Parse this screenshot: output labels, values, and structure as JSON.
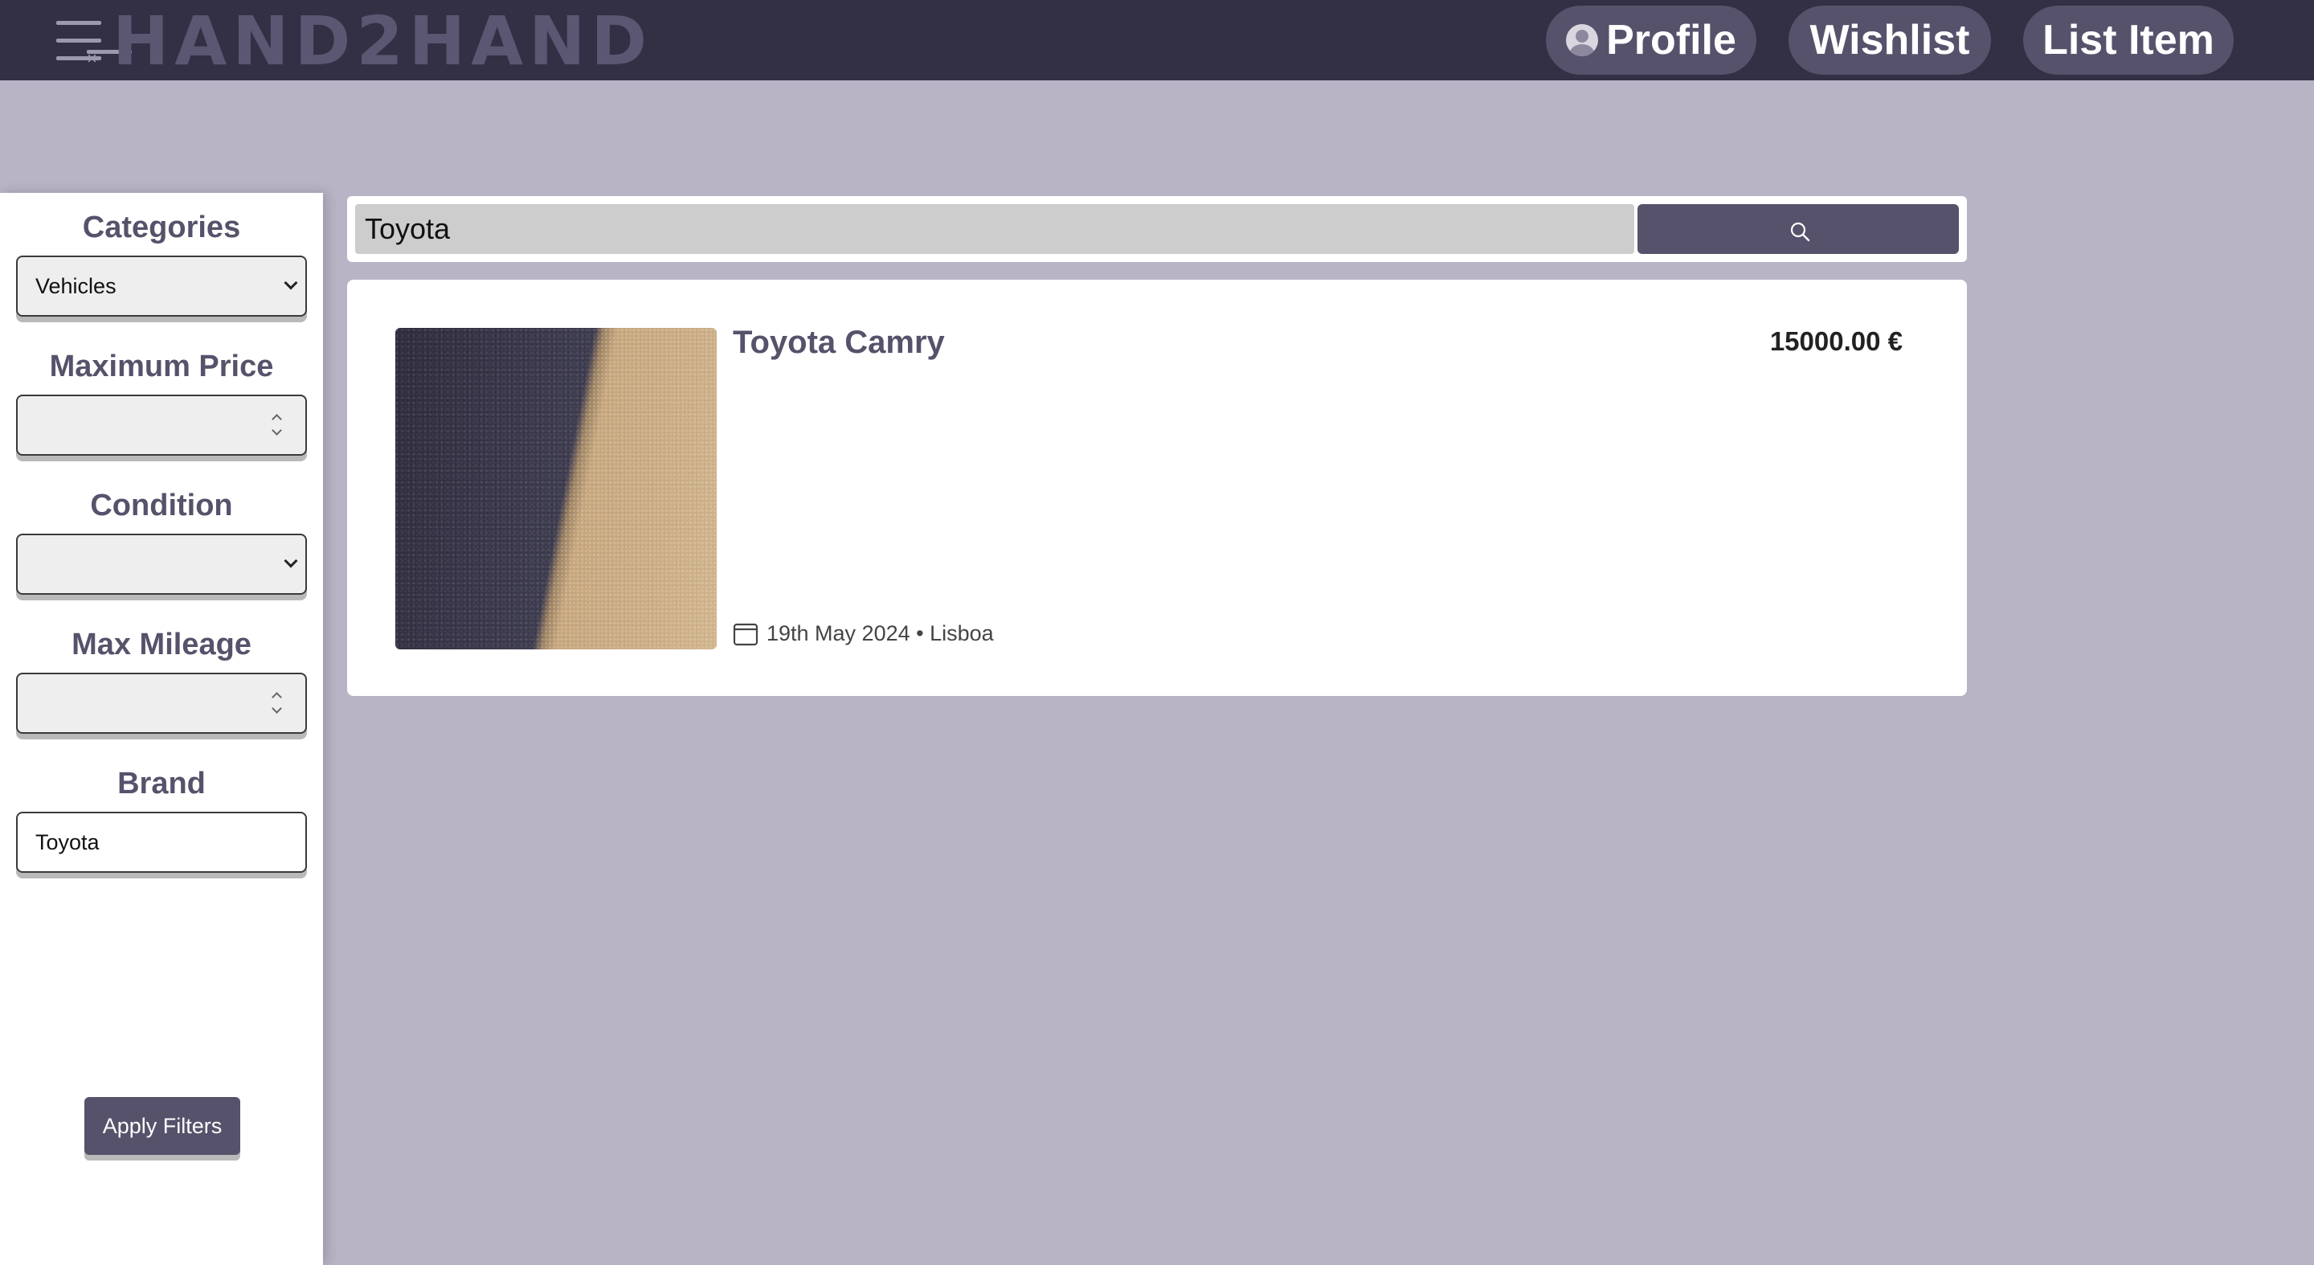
{
  "header": {
    "logo": "HAND2HAND",
    "nav": {
      "profile": "Profile",
      "wishlist": "Wishlist",
      "list_item": "List Item"
    }
  },
  "filters": {
    "categories": {
      "label": "Categories",
      "selected": "Vehicles"
    },
    "max_price": {
      "label": "Maximum Price",
      "value": ""
    },
    "condition": {
      "label": "Condition",
      "selected": ""
    },
    "max_mileage": {
      "label": "Max Mileage",
      "value": ""
    },
    "brand": {
      "label": "Brand",
      "value": "Toyota"
    },
    "apply_label": "Apply Filters"
  },
  "search": {
    "query": "Toyota"
  },
  "results": [
    {
      "title": "Toyota Camry",
      "price": "15000.00 €",
      "meta": "19th May 2024 • Lisboa"
    }
  ],
  "colors": {
    "header_bg": "#332f44",
    "accent": "#57526b",
    "page_bg": "#b8b4c6"
  },
  "icons": [
    "menu-icon",
    "user-icon",
    "search-icon",
    "calendar-icon",
    "chevron-down-icon"
  ]
}
